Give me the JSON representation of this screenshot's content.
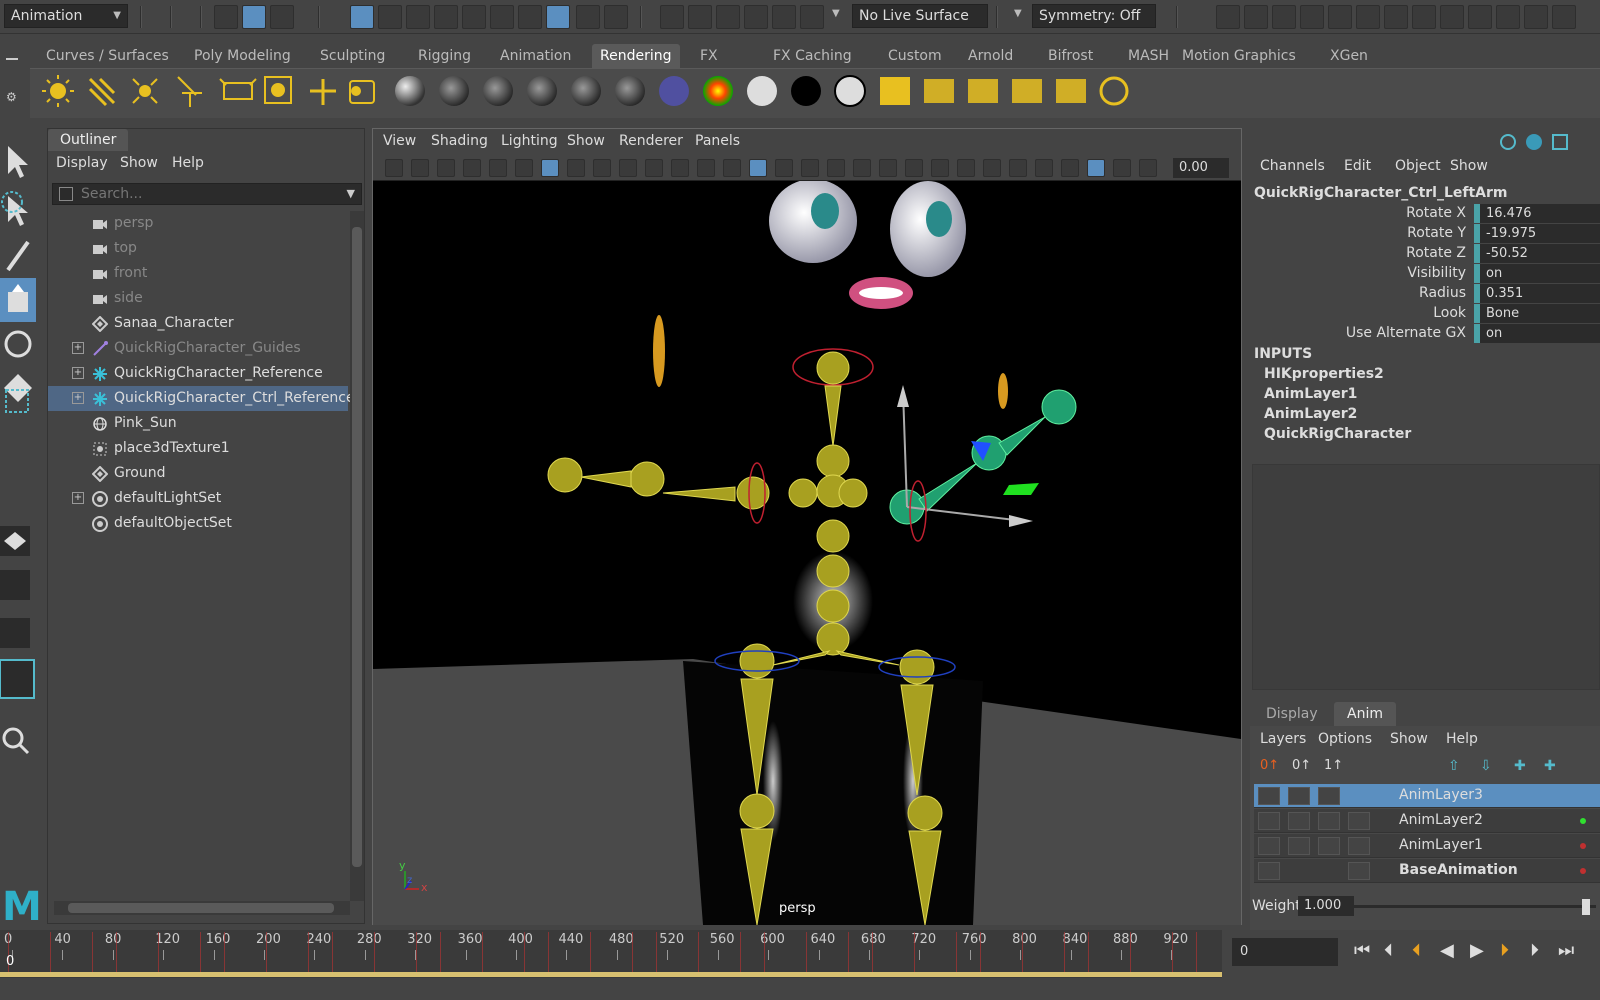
{
  "statusline": {
    "menuset": "Animation",
    "live_surface": "No Live Surface",
    "symmetry": "Symmetry: Off"
  },
  "shelf": {
    "tabs": [
      "Curves / Surfaces",
      "Poly Modeling",
      "Sculpting",
      "Rigging",
      "Animation",
      "Rendering",
      "FX",
      "FX Caching",
      "Custom",
      "Arnold",
      "Bifrost",
      "MASH",
      "Motion Graphics",
      "XGen"
    ],
    "active_tab": "Rendering"
  },
  "outliner": {
    "title": "Outliner",
    "menu": [
      "Display",
      "Show",
      "Help"
    ],
    "search_placeholder": "Search...",
    "items": [
      {
        "label": "persp",
        "icon": "camera-icon",
        "dim": true,
        "expand": false
      },
      {
        "label": "top",
        "icon": "camera-icon",
        "dim": true,
        "expand": false
      },
      {
        "label": "front",
        "icon": "camera-icon",
        "dim": true,
        "expand": false
      },
      {
        "label": "side",
        "icon": "camera-icon",
        "dim": true,
        "expand": false
      },
      {
        "label": "Sanaa_Character",
        "icon": "transform-icon",
        "dim": false,
        "expand": false
      },
      {
        "label": "QuickRigCharacter_Guides",
        "icon": "guide-icon",
        "dim": true,
        "expand": true
      },
      {
        "label": "QuickRigCharacter_Reference",
        "icon": "hik-icon",
        "dim": false,
        "expand": true
      },
      {
        "label": "QuickRigCharacter_Ctrl_Reference",
        "icon": "hik-icon",
        "dim": false,
        "expand": true,
        "selected": true
      },
      {
        "label": "Pink_Sun",
        "icon": "light-icon",
        "dim": false,
        "expand": false
      },
      {
        "label": "place3dTexture1",
        "icon": "texture-icon",
        "dim": false,
        "expand": false
      },
      {
        "label": "Ground",
        "icon": "transform-icon",
        "dim": false,
        "expand": false
      },
      {
        "label": "defaultLightSet",
        "icon": "set-icon",
        "dim": false,
        "expand": true
      },
      {
        "label": "defaultObjectSet",
        "icon": "set-icon",
        "dim": false,
        "expand": false
      }
    ]
  },
  "viewport": {
    "menu": [
      "View",
      "Shading",
      "Lighting",
      "Show",
      "Renderer",
      "Panels"
    ],
    "exposure": "0.00",
    "camera_label": "persp",
    "axis_x": "x",
    "axis_y": "y",
    "axis_z": "z"
  },
  "channel_box": {
    "menu": [
      "Channels",
      "Edit",
      "Object",
      "Show"
    ],
    "node": "QuickRigCharacter_Ctrl_LeftArm",
    "attributes": [
      {
        "label": "Rotate X",
        "value": "16.476"
      },
      {
        "label": "Rotate Y",
        "value": "-19.975"
      },
      {
        "label": "Rotate Z",
        "value": "-50.52"
      },
      {
        "label": "Visibility",
        "value": "on"
      },
      {
        "label": "Radius",
        "value": "0.351"
      },
      {
        "label": "Look",
        "value": "Bone"
      },
      {
        "label": "Use Alternate GX",
        "value": "on"
      }
    ],
    "inputs_header": "INPUTS",
    "inputs": [
      "HIKproperties2",
      "AnimLayer1",
      "AnimLayer2",
      "QuickRigCharacter"
    ]
  },
  "layer_editor": {
    "tabs": [
      "Display",
      "Anim"
    ],
    "active_tab": "Anim",
    "menu": [
      "Layers",
      "Options",
      "Show",
      "Help"
    ],
    "layers": [
      {
        "name": "AnimLayer3",
        "selected": true,
        "bold": false
      },
      {
        "name": "AnimLayer2",
        "selected": false,
        "bold": false
      },
      {
        "name": "AnimLayer1",
        "selected": false,
        "bold": false
      },
      {
        "name": "BaseAnimation",
        "selected": false,
        "bold": true
      }
    ],
    "weight_label": "Weight",
    "weight_value": "1.000"
  },
  "timeline": {
    "ticks": [
      "0",
      "40",
      "80",
      "120",
      "160",
      "200",
      "240",
      "280",
      "320",
      "360",
      "400",
      "440",
      "480",
      "520",
      "560",
      "600",
      "640",
      "680",
      "720",
      "760",
      "800",
      "840",
      "880",
      "920"
    ],
    "current_marker": "0",
    "current_frame": "0"
  },
  "colors": {
    "selection_blue": "#5b8fc0",
    "joint_yellow": "#d8d040",
    "selected_joint_green": "#40e080",
    "key_red": "#aa3333"
  }
}
